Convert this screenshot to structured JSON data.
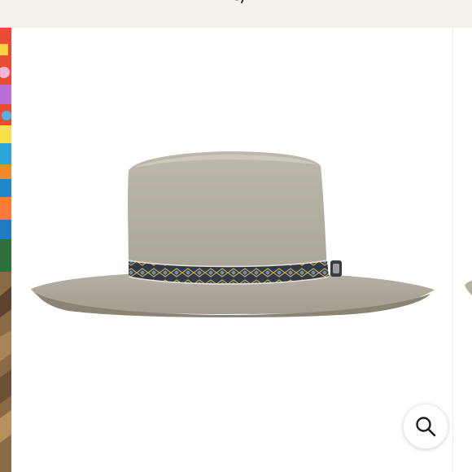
{
  "header": {
    "logo_icon": "script-logo-icon"
  },
  "gallery": {
    "product_image": "wide-brim-felt-hat",
    "previous_slide": "colorful-painting-partial",
    "next_slide": "hat-partial",
    "zoom_icon": "magnifier-icon"
  },
  "colors": {
    "page_bg": "#f3f0ea",
    "hat_felt": "#b8b3a7",
    "hat_band": "#2f3a4a"
  }
}
